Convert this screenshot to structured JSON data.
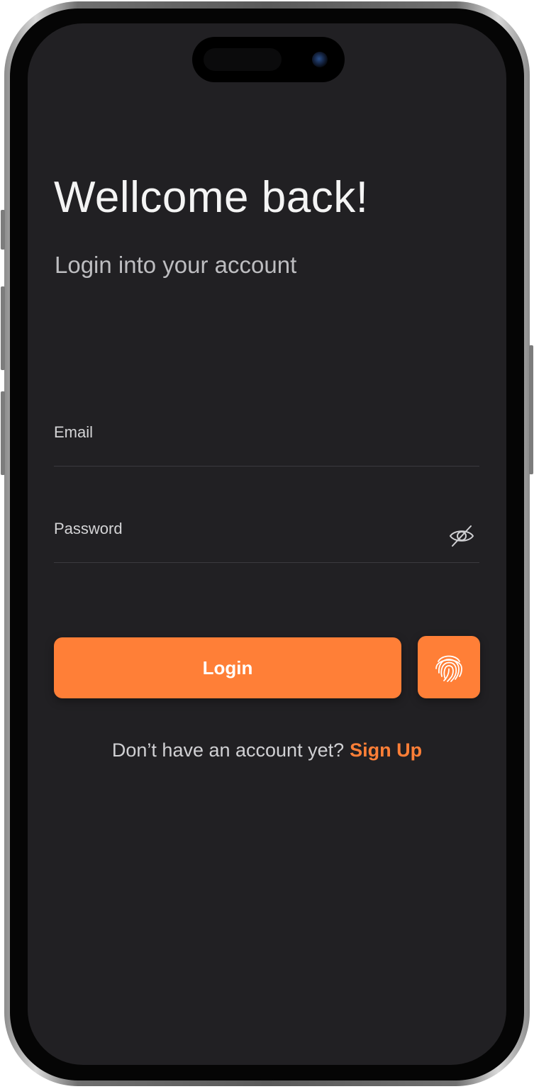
{
  "login": {
    "title": "Wellcome back!",
    "subtitle": "Login into your account",
    "email_placeholder": "Email",
    "email_value": "",
    "password_placeholder": "Password",
    "password_value": "",
    "login_button_label": "Login",
    "signup_prompt": "Don’t have an account yet?",
    "signup_link_label": "Sign Up"
  },
  "icons": {
    "password_toggle": "eye-slash-icon",
    "biometric": "fingerprint-icon"
  },
  "colors": {
    "accent": "#ff7f37",
    "background": "#212023",
    "text_primary": "#f4f4f4",
    "text_secondary": "#bdbdc0",
    "divider": "#3b3a3e"
  }
}
